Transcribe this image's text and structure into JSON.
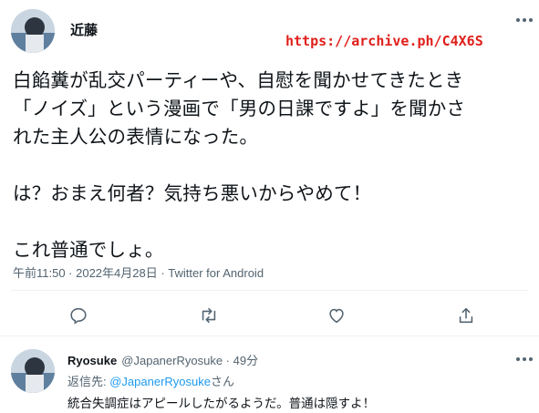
{
  "tweet": {
    "author_name": "近藤",
    "annotation": "https://archive.ph/C4X6S",
    "body_lines": [
      "白餡糞が乱交パーティーや、自慰を聞かせてきたとき",
      "「ノイズ」という漫画で「男の日課ですよ」を聞かさ",
      "れた主人公の表情になった。",
      "",
      "は？おまえ何者？気持ち悪いからやめて！",
      "",
      "これ普通でしょ。"
    ],
    "meta": "午前11:50 · 2022年4月28日 · Twitter for Android",
    "actions": [
      "reply-icon",
      "retweet-icon",
      "like-icon",
      "share-icon"
    ]
  },
  "reply": {
    "author_name": "Ryosuke",
    "handle": "@JapanerRyosuke",
    "separator": " · ",
    "time": "49分",
    "reply_to_prefix": "返信先: ",
    "reply_to_handle": "@JapanerRyosuke",
    "reply_to_suffix": "さん",
    "text": "統合失調症はアピールしたがるようだ。普通は隠すよ！"
  },
  "colors": {
    "annotation": "#e0201b",
    "link": "#1d9bf0",
    "secondary_text": "#536471",
    "divider": "#eff3f4"
  }
}
